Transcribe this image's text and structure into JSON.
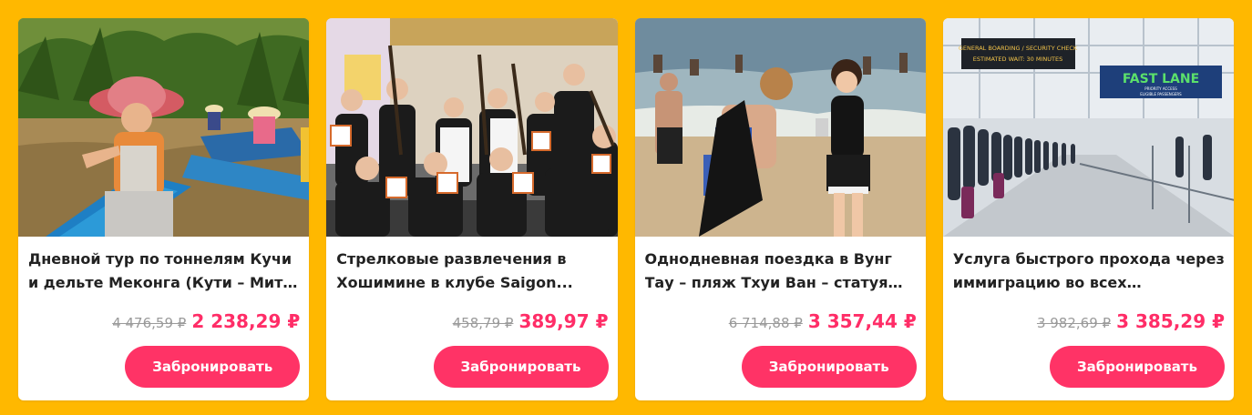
{
  "theme": {
    "background": "#FFB800",
    "accent": "#FF3366",
    "price_color": "#FF2D67"
  },
  "cards": [
    {
      "title": "Дневной тур по тоннелям Кучи и дельте Меконга (Кути – Мито –...",
      "old_price": "4 476,59 ₽",
      "new_price": "2 238,29 ₽",
      "button": "Забронировать"
    },
    {
      "title": "Стрелковые развлечения в Хошимине в клубе Saigon...",
      "old_price": "458,79 ₽",
      "new_price": "389,97 ₽",
      "button": "Забронировать"
    },
    {
      "title": "Однодневная поездка в Вунг Тау – пляж Тхуи Ван – статуя Иисуса...",
      "old_price": "6 714,88 ₽",
      "new_price": "3 357,44 ₽",
      "button": "Забронировать"
    },
    {
      "title": "Услуга быстрого прохода через иммиграцию во всех аэропортах...",
      "old_price": "3 982,69 ₽",
      "new_price": "3 385,29 ₽",
      "button": "Забронировать"
    }
  ],
  "photo_signs": {
    "airport_board_line1": "GENERAL BOARDING / SECURITY CHECK",
    "airport_board_line2": "ESTIMATED WAIT: 30 MINUTES",
    "fast_lane": "FAST LANE",
    "fast_lane_sub1": "PRIORITY ACCESS",
    "fast_lane_sub2": "ELIGIBLE PASSENGERS"
  }
}
